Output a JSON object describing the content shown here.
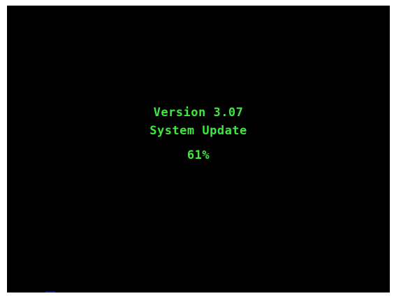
{
  "screen": {
    "version_text": "Version 3.07",
    "title": "System Update",
    "progress_text": "61%",
    "progress_value": 61,
    "text_color": "#3ee83e",
    "background_color": "#000000"
  }
}
